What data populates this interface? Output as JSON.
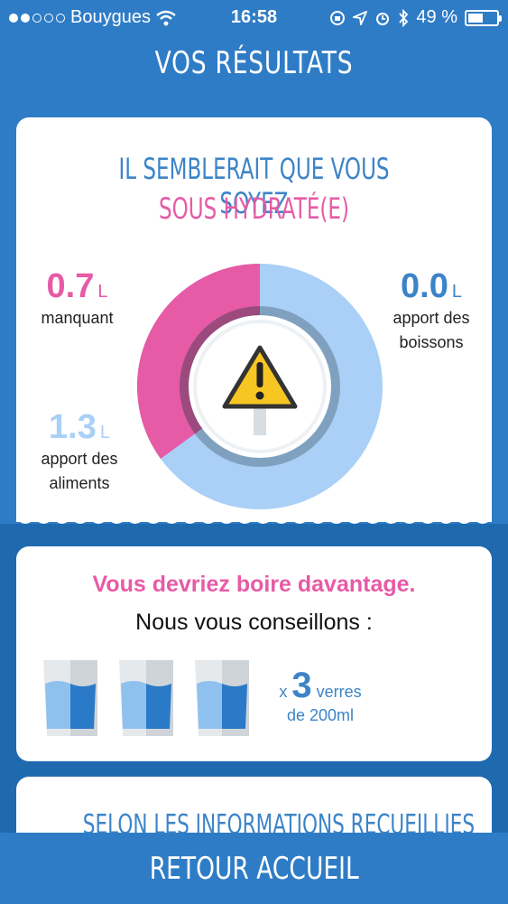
{
  "status_bar": {
    "carrier": "Bouygues",
    "time": "16:58",
    "battery": "49 %"
  },
  "header": {
    "title": "VOS RÉSULTATS"
  },
  "result_card": {
    "headline_line1": "IL SEMBLERAIT QUE VOUS SOYEZ",
    "headline_line2": "SOUS HYDRATÉ(E)",
    "missing": {
      "value": "0.7",
      "unit": "L",
      "label": "manquant"
    },
    "drinks": {
      "value": "0.0",
      "unit": "L",
      "label_line1": "apport des",
      "label_line2": "boissons"
    },
    "food": {
      "value": "1.3",
      "unit": "L",
      "label_line1": "apport des",
      "label_line2": "aliments"
    },
    "gauge_missing_fraction": 0.35,
    "warning_icon": "warning-triangle-icon",
    "colors": {
      "pink": "#e75aa6",
      "blue": "#3c84c8",
      "light_blue": "#aad0f7"
    }
  },
  "advice_card": {
    "line1": "Vous devriez boire davantage.",
    "line2": "Nous vous conseillons :",
    "glasses_icon": "water-glass-icon",
    "multiplier": "x",
    "count": "3",
    "unit": "verres",
    "size": "de 200ml"
  },
  "info_card": {
    "title": "SELON LES INFORMATIONS RECUEILLIES"
  },
  "footer": {
    "button_label": "RETOUR ACCUEIL"
  }
}
